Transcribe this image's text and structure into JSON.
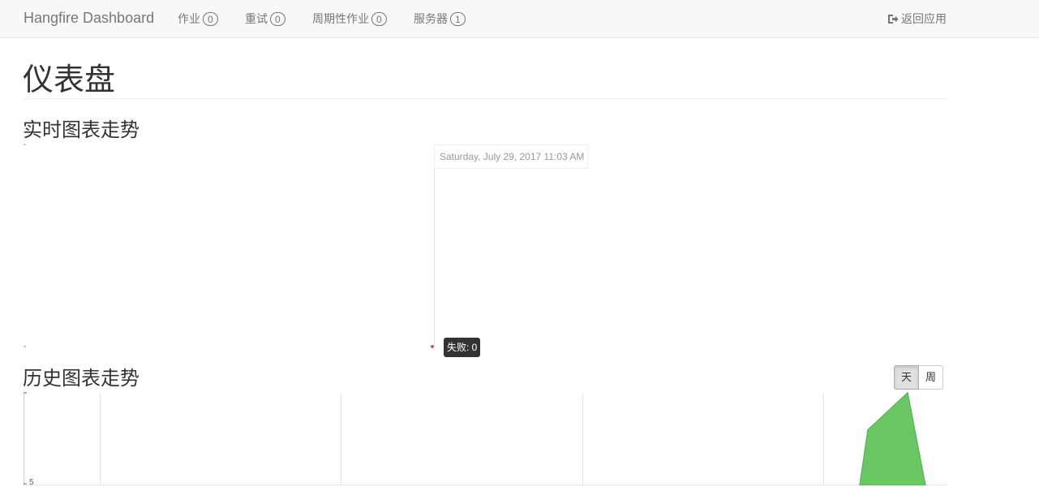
{
  "navbar": {
    "brand": "Hangfire Dashboard",
    "items": [
      {
        "label": "作业",
        "count": "0"
      },
      {
        "label": "重试",
        "count": "0"
      },
      {
        "label": "周期性作业",
        "count": "0"
      },
      {
        "label": "服务器",
        "count": "1"
      }
    ],
    "back_label": "返回应用",
    "back_icon": "sign-out-icon"
  },
  "page": {
    "title": "仪表盘"
  },
  "realtime": {
    "title": "实时图表走势",
    "hover_date": "Saturday, July 29, 2017 11:03 AM",
    "hover_series": "失败: 0"
  },
  "history": {
    "title": "历史图表走势",
    "period_buttons": [
      {
        "label": "天",
        "active": true
      },
      {
        "label": "周",
        "active": false
      }
    ],
    "y_tick": "5"
  },
  "colors": {
    "succeeded": "#6ac864",
    "failed": "#d9534f"
  },
  "chart_data": [
    {
      "type": "line",
      "title": "实时图表走势",
      "series": [
        {
          "name": "失败",
          "values": [
            0
          ]
        }
      ]
    },
    {
      "type": "area",
      "title": "历史图表走势",
      "ylim": [
        0,
        10
      ],
      "yticks": [
        5
      ],
      "series": [
        {
          "values": [
            0,
            6,
            10,
            0
          ]
        }
      ]
    }
  ]
}
